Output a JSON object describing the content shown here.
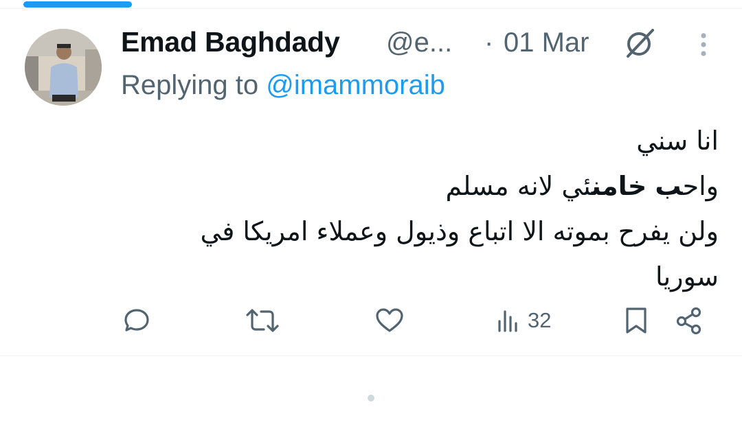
{
  "tweet": {
    "author_name": "Emad Baghdady",
    "handle": "@e...",
    "separator": "·",
    "date": "01 Mar",
    "replying_prefix": "Replying to ",
    "replying_to": "@imammoraib",
    "body": {
      "line1": "انا سني",
      "line2_pre": "واح",
      "line2_bold1": "ب",
      "line2_mid": " ",
      "line2_bold2": "خامن",
      "line2_post": "ئي لانه مسلم",
      "line3": "ولن يفرح بموته الا اتباع وذيول وعملاء امريكا في",
      "line4": "سوريا"
    }
  },
  "actions": {
    "views_count": "32"
  },
  "icons": {
    "grok": "grok-icon",
    "more": "more-vertical-icon",
    "reply": "reply-icon",
    "retweet": "retweet-icon",
    "like": "like-icon",
    "views": "views-icon",
    "bookmark": "bookmark-icon",
    "share": "share-icon"
  },
  "colors": {
    "accent": "#1d9bf0",
    "secondary_text": "#536471",
    "primary_text": "#0f1419"
  }
}
